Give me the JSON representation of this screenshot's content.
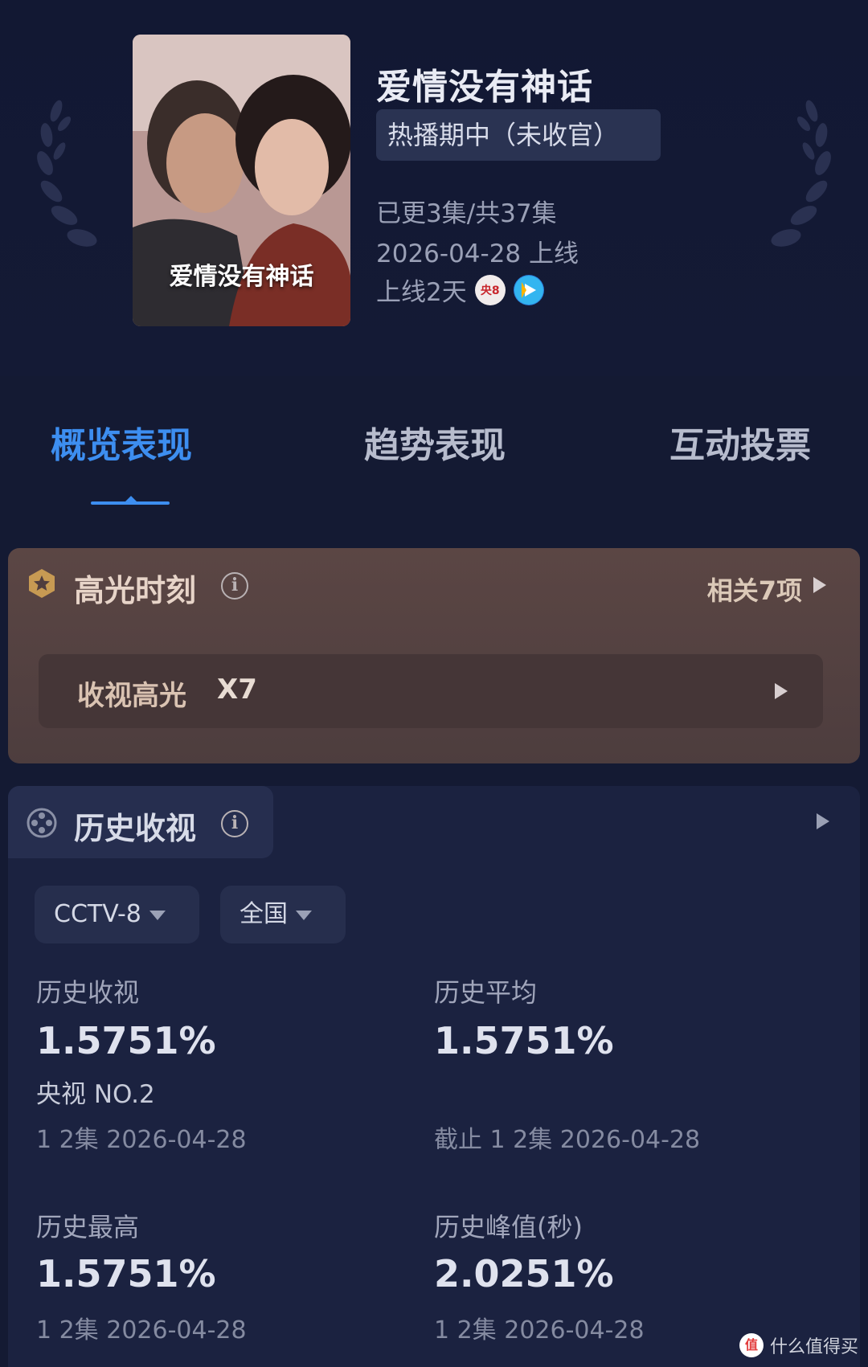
{
  "show": {
    "title": "爱情没有神话",
    "poster_title": "爱情没有神话",
    "status": "热播期中（未收官）",
    "episodes": "已更3集/共37集",
    "release": "2026-04-28 上线",
    "days_online": "上线2天",
    "channel_badge": "央8",
    "icons": {
      "channel": "cctv8-icon",
      "platform": "tencent-video-play-icon"
    }
  },
  "tabs": [
    {
      "label": "概览表现",
      "active": true
    },
    {
      "label": "趋势表现",
      "active": false
    },
    {
      "label": "互动投票",
      "active": false
    }
  ],
  "highlight": {
    "title": "高光时刻",
    "related": "相关7项",
    "row_label": "收视高光",
    "row_count": "X7"
  },
  "history": {
    "title": "历史收视",
    "channel_select": "CCTV-8",
    "region_select": "全国",
    "stats": [
      {
        "label": "历史收视",
        "value": "1.5751%",
        "rank": "央视  NO.2",
        "sub": "1 2集  2026-04-28"
      },
      {
        "label": "历史平均",
        "value": "1.5751%",
        "rank": "",
        "sub": "截止 1 2集  2026-04-28"
      },
      {
        "label": "历史最高",
        "value": "1.5751%",
        "rank": "",
        "sub": "1 2集  2026-04-28"
      },
      {
        "label": "历史峰值(秒)",
        "value": "2.0251%",
        "rank": "",
        "sub": "1 2集  2026-04-28"
      }
    ]
  },
  "watermark": {
    "icon_text": "值",
    "text": "什么值得买"
  },
  "colors": {
    "background": "#141a33",
    "accent_blue": "#3d8ef0",
    "highlight_card": "#5b4644",
    "history_card": "#1b2240"
  }
}
